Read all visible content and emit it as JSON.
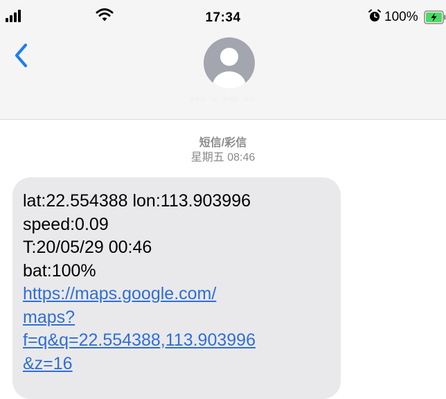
{
  "status_bar": {
    "time": "17:34",
    "battery_percent": "100%",
    "battery_level": 1.0,
    "icons": [
      "signal-icon",
      "wifi-icon",
      "alarm-icon",
      "battery-charging-icon"
    ]
  },
  "header": {
    "back_icon": "chevron-left-icon",
    "avatar_icon": "person-avatar-icon",
    "contact_name": "··· · ··· ··"
  },
  "conversation": {
    "service_label": "短信/彩信",
    "date_label": "星期五 08:46"
  },
  "message": {
    "lines": [
      "lat:22.554388 lon:113.903996",
      "speed:0.09",
      "T:20/05/29 00:46",
      "bat:100%"
    ],
    "link_lines": [
      "https://maps.google.com/",
      "maps?",
      "f=q&q=22.554388,113.903996",
      "&z=16"
    ]
  },
  "colors": {
    "accent": "#2f6ed6",
    "ios_blue": "#1e7cf2",
    "bubble": "#e9e9eb",
    "header_bg": "#f5f5f5",
    "battery_green": "#4cd964"
  }
}
